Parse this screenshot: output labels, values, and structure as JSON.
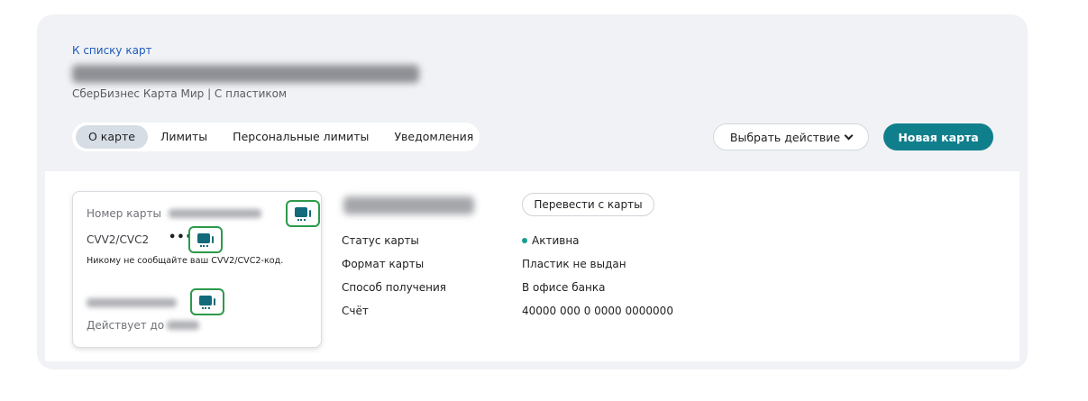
{
  "header": {
    "back_link": "К списку карт",
    "subtitle": "СберБизнес Карта Мир | С пластиком"
  },
  "tabs": [
    {
      "label": "О карте",
      "active": true
    },
    {
      "label": "Лимиты",
      "active": false
    },
    {
      "label": "Персональные лимиты",
      "active": false
    },
    {
      "label": "Уведомления",
      "active": false
    }
  ],
  "actions": {
    "choose_action": "Выбрать действие",
    "new_card": "Новая карта",
    "transfer_cards": "Перевести с карты"
  },
  "card": {
    "number_label": "Номер карты",
    "cvv_label": "CVV2/CVC2",
    "cvv_mask": "•••",
    "cvv_warning": "Никому не сообщайте ваш CVV2/CVC2-код.",
    "valid_until_label": "Действует до"
  },
  "details": [
    {
      "label": "Статус карты",
      "value": "Активна"
    },
    {
      "label": "Формат карты",
      "value": "Пластик не выдан"
    },
    {
      "label": "Способ получения",
      "value": "В офисе банка"
    },
    {
      "label": "Счёт",
      "value": "40000 000 0 0000 0000000"
    }
  ],
  "colors": {
    "accent": "#107f8c",
    "copy_highlight": "#2c9a4a",
    "status_active": "#1a9c8c",
    "link": "#1e5bb8"
  }
}
